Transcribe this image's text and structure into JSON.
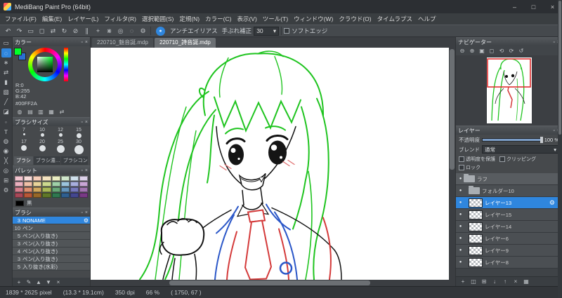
{
  "window": {
    "title": "MediBang Paint Pro (64bit)"
  },
  "window_controls": [
    {
      "name": "minimize-button",
      "glyph": "–"
    },
    {
      "name": "maximize-button",
      "glyph": "□"
    },
    {
      "name": "close-button",
      "glyph": "×"
    }
  ],
  "icons": {
    "panel_collapse": "▫",
    "panel_close": "×",
    "dropdown_arrow": "▾",
    "gear": "⚙",
    "visible_dot": "●"
  },
  "menu": {
    "items": [
      "ファイル(F)",
      "編集(E)",
      "レイヤー(L)",
      "フィルタ(R)",
      "選択範囲(S)",
      "定規(N)",
      "カラー(C)",
      "表示(V)",
      "ツール(T)",
      "ウィンドウ(W)",
      "クラウド(O)",
      "タイムラプス",
      "ヘルプ"
    ]
  },
  "toolbar": {
    "icons": [
      {
        "name": "undo-icon",
        "glyph": "↶"
      },
      {
        "name": "redo-icon",
        "glyph": "↷"
      },
      {
        "name": "deselect-icon",
        "glyph": "▭"
      },
      {
        "name": "transform-icon",
        "glyph": "◻"
      },
      {
        "name": "flip-canvas-icon",
        "glyph": "⇄"
      },
      {
        "name": "rotate-canvas-icon",
        "glyph": "↻"
      },
      {
        "name": "snap-off-icon",
        "glyph": "⊘"
      },
      {
        "name": "snap-parallel-icon",
        "glyph": "∥"
      },
      {
        "name": "snap-cross-icon",
        "glyph": "+"
      },
      {
        "name": "snap-vanishing-icon",
        "glyph": "⋇"
      },
      {
        "name": "snap-radial-icon",
        "glyph": "◎"
      },
      {
        "name": "snap-ellipse-icon",
        "glyph": "◌"
      },
      {
        "name": "snap-settings-icon",
        "glyph": "⚙"
      }
    ],
    "brush_type_icon_glyph": "●",
    "antialias_label": "アンチエイリアス",
    "stabilizer_label": "手ぶれ補正",
    "stabilizer_value": "30",
    "softedge_label": "ソフトエッジ"
  },
  "tool_strip": {
    "tools": [
      {
        "name": "marquee-select-tool",
        "glyph": "▭"
      },
      {
        "name": "lasso-tool",
        "glyph": "◌",
        "active": true
      },
      {
        "name": "magic-wand-tool",
        "glyph": "∗"
      },
      {
        "name": "move-tool",
        "glyph": "⇄"
      },
      {
        "name": "fill-tool",
        "glyph": "▮"
      },
      {
        "name": "gradient-tool",
        "glyph": "▧"
      },
      {
        "name": "brush-tool",
        "glyph": "╱"
      },
      {
        "name": "eraser-tool",
        "glyph": "◪"
      },
      {
        "name": "dot-tool",
        "glyph": "◦"
      },
      {
        "name": "text-tool",
        "glyph": "T"
      },
      {
        "name": "dropper-tool",
        "glyph": "◍"
      },
      {
        "name": "hand-tool",
        "glyph": "◉"
      },
      {
        "name": "divide-tool",
        "glyph": "╳"
      },
      {
        "name": "zoom-tool",
        "glyph": "◎"
      },
      {
        "name": "grid-tool",
        "glyph": "⊞"
      },
      {
        "name": "tool-settings",
        "glyph": "⚙"
      }
    ]
  },
  "color_panel": {
    "title": "カラー",
    "foreground": "#00FF2A",
    "background": "#2a6fd4",
    "rgb_lines": [
      "R:0",
      "G:255",
      "B:42"
    ],
    "hex": "#00FF2A",
    "footer_icons": [
      {
        "name": "color-wheel-mode-icon",
        "glyph": "◍"
      },
      {
        "name": "color-bar-mode-icon",
        "glyph": "▤"
      },
      {
        "name": "color-slider-mode-icon",
        "glyph": "▥"
      },
      {
        "name": "color-grid-mode-icon",
        "glyph": "▦"
      },
      {
        "name": "swap-colors-icon",
        "glyph": "⇄"
      }
    ]
  },
  "brush_size_panel": {
    "title": "ブラシサイズ",
    "sizes": [
      7,
      10,
      12,
      15,
      17,
      20,
      25,
      30
    ]
  },
  "left_panel_tabs": [
    {
      "label": "ブラシ"
    },
    {
      "label": "ブラシ濃…"
    },
    {
      "label": "ブラシコン…"
    }
  ],
  "palette_panel": {
    "title": "パレット",
    "colors": [
      "#f2c4cf",
      "#f7dbd9",
      "#f6cdb8",
      "#f3e3c0",
      "#e9edc2",
      "#cfe6cb",
      "#cfe0ec",
      "#dcd2ea",
      "#eab0bf",
      "#efc0a8",
      "#e8d49a",
      "#ccd98f",
      "#9fd0a8",
      "#9cc4dc",
      "#a8aede",
      "#c9a6d6",
      "#d5808f",
      "#dd9070",
      "#d0a85f",
      "#a8b858",
      "#68a878",
      "#6495bc",
      "#7678bc",
      "#a276b2",
      "#a84858",
      "#b85838",
      "#986828",
      "#607828",
      "#2f7850",
      "#2f5f8f",
      "#44478f",
      "#793a86"
    ],
    "black_label": "黒",
    "black_color": "#000000"
  },
  "brush_panel": {
    "title": "ブラシ",
    "brushes": [
      {
        "size": "3",
        "name": "NONAME",
        "selected": true
      },
      {
        "size": "10",
        "name": "ペン"
      },
      {
        "size": "5",
        "name": "ペン(入り抜き)"
      },
      {
        "size": "3",
        "name": "ペン(入り抜き)"
      },
      {
        "size": "4",
        "name": "ペン(入り抜き)"
      },
      {
        "size": "3",
        "name": "ペン(入り抜き)"
      },
      {
        "size": "5",
        "name": "入り抜き(水彩)"
      }
    ],
    "footer_icons": [
      {
        "name": "add-brush-icon",
        "glyph": "+"
      },
      {
        "name": "edit-brush-icon",
        "glyph": "✎"
      },
      {
        "name": "brush-up-icon",
        "glyph": "▲"
      },
      {
        "name": "brush-down-icon",
        "glyph": "▼"
      },
      {
        "name": "delete-brush-icon",
        "glyph": "×"
      }
    ]
  },
  "canvas": {
    "tabs": [
      {
        "label": "220710_魅音誕.mdp",
        "active": false
      },
      {
        "label": "220710_詩音誕.mdp",
        "active": true
      }
    ]
  },
  "navigator": {
    "title": "ナビゲーター",
    "icons": [
      {
        "name": "nav-zoom-out-icon",
        "glyph": "⊖"
      },
      {
        "name": "nav-zoom-in-icon",
        "glyph": "⊕"
      },
      {
        "name": "nav-fit-icon",
        "glyph": "▣"
      },
      {
        "name": "nav-actual-size-icon",
        "glyph": "◻"
      },
      {
        "name": "nav-rotate-left-icon",
        "glyph": "⟲"
      },
      {
        "name": "nav-rotate-right-icon",
        "glyph": "⟳"
      },
      {
        "name": "nav-reset-icon",
        "glyph": "↺"
      }
    ]
  },
  "layers_panel": {
    "title": "レイヤー",
    "opacity_label": "不透明度",
    "opacity_value": "100 %",
    "blend_label": "ブレンド",
    "blend_value": "通常",
    "checkboxes": [
      {
        "name": "protect-alpha-checkbox",
        "label": "透明度を保護",
        "checked": false
      },
      {
        "name": "clipping-checkbox",
        "label": "クリッピング",
        "checked": false
      },
      {
        "name": "lock-checkbox",
        "label": "ロック",
        "checked": false
      }
    ],
    "layers": [
      {
        "name": "ラフ",
        "kind": "folder",
        "depth": 0,
        "dark": true
      },
      {
        "name": "フォルダー10",
        "kind": "folder",
        "depth": 1
      },
      {
        "name": "レイヤー13",
        "kind": "layer",
        "depth": 1,
        "selected": true
      },
      {
        "name": "レイヤー15",
        "kind": "layer",
        "depth": 1
      },
      {
        "name": "レイヤー14",
        "kind": "layer",
        "depth": 1
      },
      {
        "name": "レイヤー6",
        "kind": "layer",
        "depth": 1
      },
      {
        "name": "レイヤー9",
        "kind": "layer",
        "depth": 1
      },
      {
        "name": "レイヤー8",
        "kind": "layer",
        "depth": 1
      }
    ],
    "footer_icons": [
      {
        "name": "add-layer-icon",
        "glyph": "+"
      },
      {
        "name": "add-folder-icon",
        "glyph": "◫"
      },
      {
        "name": "duplicate-layer-icon",
        "glyph": "⊞"
      },
      {
        "name": "merge-down-icon",
        "glyph": "↓"
      },
      {
        "name": "move-layer-up-icon",
        "glyph": "↑"
      },
      {
        "name": "clear-layer-icon",
        "glyph": "×"
      },
      {
        "name": "delete-layer-icon",
        "glyph": "▦"
      }
    ]
  },
  "statusbar": {
    "segments": [
      "1839 * 2625 pixel",
      "(13.3 * 19.1cm)",
      "350 dpi",
      "66 %",
      "( 1750, 67 )"
    ]
  }
}
